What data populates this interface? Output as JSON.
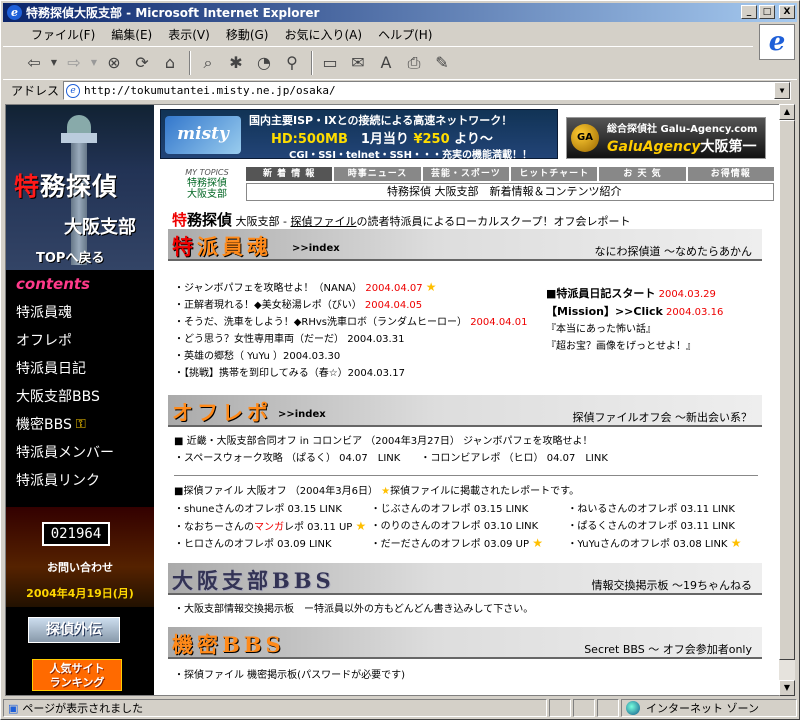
{
  "window": {
    "title": "特務探偵大阪支部 - Microsoft Internet Explorer",
    "min": "_",
    "max": "□",
    "close": "X"
  },
  "menu": [
    "ファイル(F)",
    "編集(E)",
    "表示(V)",
    "移動(G)",
    "お気に入り(A)",
    "ヘルプ(H)"
  ],
  "address": {
    "label": "アドレス",
    "url": "http://tokumutantei.misty.ne.jp/osaka/"
  },
  "status": {
    "text": "ページが表示されました",
    "zone": "インターネット ゾーン"
  },
  "sidebar": {
    "title_red": "特",
    "title_rest": "務探偵",
    "subtitle": "大阪支部",
    "top_link": "TOPへ戻る",
    "contents_label": "contents",
    "nav": [
      "特派員魂",
      "オフレポ",
      "特派員日記",
      "大阪支部BBS",
      "機密BBS",
      "特派員メンバー",
      "特派員リンク"
    ],
    "counter": "021964",
    "contact": "お問い合わせ",
    "date": "2004年4月19日(月)",
    "banner_a": "探偵外伝",
    "banner_b_l1": "人気サイト",
    "banner_b_l2": "ランキング"
  },
  "ads": {
    "misty_logo": "misty net",
    "misty_l1": "国内主要ISP・IXとの接続による高速ネットワーク！",
    "misty_hd": "HD:",
    "misty_hd_val": "500MB",
    "misty_monthly": "1月当り",
    "misty_price": "¥250",
    "misty_from": "より〜",
    "misty_l3": "CGI・SSI・telnet・SSH・・・充実の機能満載！！",
    "galu_globe": "GA",
    "galu_l1": "総合探偵社 Galu-Agency.com",
    "galu_name": "GaluAgency",
    "galu_branch": "大阪第一"
  },
  "topics": {
    "label_small": "MY TOPICS",
    "label_l1": "特務探偵",
    "label_l2": "大阪支部",
    "tabs": [
      "新 着 情 報",
      "時事ニュース",
      "芸能・スポーツ",
      "ヒットチャート",
      "お 天 気",
      "お得情報"
    ],
    "line": "特務探偵 大阪支部　新着情報＆コンテンツ紹介"
  },
  "intro": {
    "big_red": "特",
    "big_rest": "務探偵",
    "text_a": " 大阪支部 - ",
    "text_link": "探偵ファイル",
    "text_b": "の読者特派員によるローカルスクープ！オフ会レポート"
  },
  "sec1": {
    "title_red": "特",
    "title_rest": "派員魂",
    "index": ">>index",
    "right": "なにわ探偵道 〜なめたらあかん",
    "items": [
      {
        "text": "・ジャンボパフェを攻略せよ！（NANA）",
        "date": "2004.04.07",
        "star": "★"
      },
      {
        "text": "・正解者現れる！◆美女秘湯レポ（びい）",
        "date": "2004.04.05",
        "star": ""
      },
      {
        "text": "・そうだ、洗車をしよう！◆RHvs洗車ロボ（ランダムヒーロー）",
        "date": "2004.04.01",
        "star": ""
      },
      {
        "text": "・どう思う？女性専用車両（だーだ）",
        "date": "2004.03.31",
        "star": ""
      },
      {
        "text": "・英雄の郷愁（ YuYu ）",
        "date": "2004.03.30",
        "star": ""
      },
      {
        "text": "・【挑戦】携帯を到印してみる（春☆）",
        "date": "2004.03.17",
        "star": ""
      }
    ],
    "diary_head": "■特派員日記スタート",
    "diary_date1": "2004.03.29",
    "mission": "【Mission】>>Click",
    "diary_date2": "2004.03.16",
    "diary_l3": "『本当にあった怖い話』",
    "diary_l4": "『超お宝？画像をげっとせよ！』"
  },
  "sec2": {
    "title": "オフレポ",
    "index": ">>index",
    "right": "探偵ファイルオフ会 〜新出会い系？",
    "l1": "■ 近畿・大阪支部合同オフ in コロンビア （2004年3月27日） ジャンボパフェを攻略せよ！",
    "l2a": "・スペースウォーク攻略 （ぱるく） 04.07　LINK",
    "l2b": "・コロンビアレポ （ヒロ） 04.07　LINK",
    "l3a": "■探偵ファイル 大阪オフ （2004年3月6日）",
    "l3star": "★",
    "l3b": "探偵ファイルに掲載されたレポートです。",
    "col1": [
      {
        "text": "・shuneさんのオフレポ 03.15 LINK",
        "star": ""
      },
      {
        "text": "・なおちーさんの",
        "red": "マンガ",
        "rest": "レポ 03.11 UP",
        "star": "★"
      },
      {
        "text": "・ヒロさんのオフレポ 03.09 LINK",
        "star": ""
      }
    ],
    "col2": [
      {
        "text": "・じぶさんのオフレポ 03.15 LINK",
        "star": ""
      },
      {
        "text": "・のりのさんのオフレポ 03.10 LINK",
        "star": ""
      },
      {
        "text": "・だーださんのオフレポ 03.09 UP",
        "star": "★"
      }
    ],
    "col3": [
      {
        "text": "・ねいるさんのオフレポ 03.11 LINK",
        "star": ""
      },
      {
        "text": "・ぱるくさんのオフレポ 03.11 LINK",
        "star": ""
      },
      {
        "text": "・YuYuさんのオフレポ 03.08 LINK",
        "star": "★"
      }
    ]
  },
  "sec3": {
    "title": "大阪支部BBS",
    "right": "情報交換掲示板 〜19ちゃんねる",
    "line": "・大阪支部情報交換掲示板　ー特派員以外の方もどんどん書き込みして下さい。"
  },
  "sec4": {
    "title": "機密BBS",
    "right": "Secret BBS 〜 オフ会参加者only",
    "line": "・探偵ファイル 機密掲示板(パスワードが必要です)"
  },
  "colors": {
    "accent_red": "#e00000",
    "title_orange": "#ff8a1a",
    "sidebar_bg": "#000000",
    "contents_pink": "#ff3a8a"
  }
}
